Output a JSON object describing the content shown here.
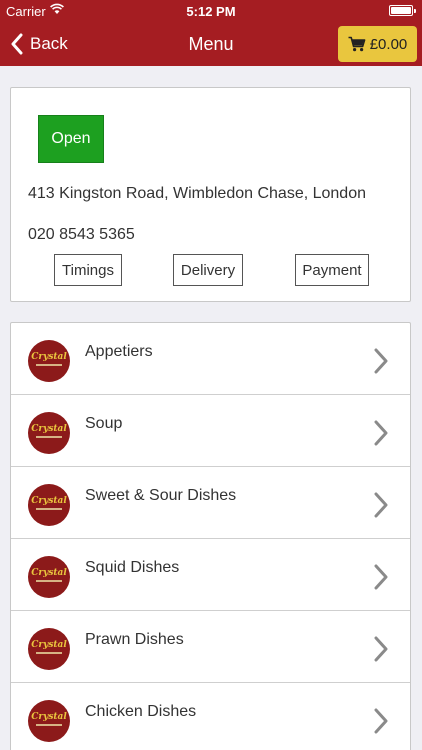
{
  "status_bar": {
    "carrier": "Carrier",
    "time": "5:12 PM"
  },
  "nav": {
    "back_label": "Back",
    "title": "Menu",
    "cart_total": "£0.00"
  },
  "shop": {
    "status": "Open",
    "address": "413 Kingston Road, Wimbledon Chase, London",
    "phone": "020 8543 5365",
    "buttons": {
      "timings": "Timings",
      "delivery": "Delivery",
      "payment": "Payment"
    }
  },
  "menu": {
    "logo_text": "Crystal",
    "categories": [
      {
        "label": "Appetiers"
      },
      {
        "label": "Soup"
      },
      {
        "label": "Sweet & Sour Dishes"
      },
      {
        "label": "Squid Dishes"
      },
      {
        "label": "Prawn Dishes"
      },
      {
        "label": "Chicken Dishes"
      }
    ]
  },
  "colors": {
    "brand_red": "#a51d22",
    "cart_yellow": "#e9c63e",
    "open_green": "#1da020",
    "logo_red": "#8c1a1a"
  },
  "icons": [
    "wifi-icon",
    "battery-icon",
    "back-chevron-icon",
    "cart-icon",
    "restaurant-logo-icon",
    "chevron-right-icon"
  ]
}
